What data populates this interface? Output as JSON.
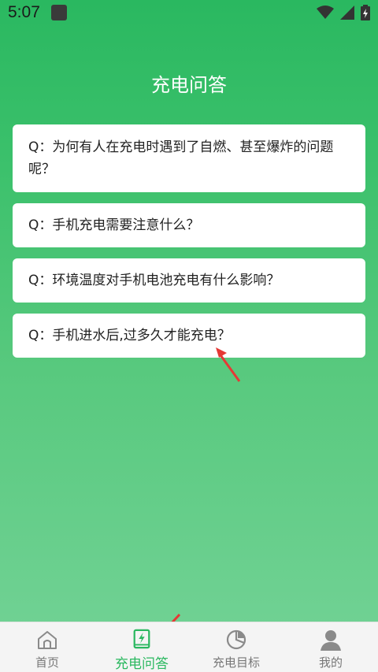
{
  "status": {
    "time": "5:07"
  },
  "page": {
    "title": "充电问答"
  },
  "faq": [
    {
      "text": "Q：为何有人在充电时遇到了自燃、甚至爆炸的问题呢？"
    },
    {
      "text": "Q：手机充电需要注意什么？"
    },
    {
      "text": "Q：环境温度对手机电池充电有什么影响？"
    },
    {
      "text": "Q：手机进水后,过多久才能充电？"
    }
  ],
  "tabs": [
    {
      "label": "首页",
      "icon": "home-icon"
    },
    {
      "label": "充电问答",
      "icon": "charge-book-icon"
    },
    {
      "label": "充电目标",
      "icon": "pie-chart-icon"
    },
    {
      "label": "我的",
      "icon": "user-icon"
    }
  ],
  "colors": {
    "accent": "#2bb860",
    "arrow": "#e53935"
  }
}
